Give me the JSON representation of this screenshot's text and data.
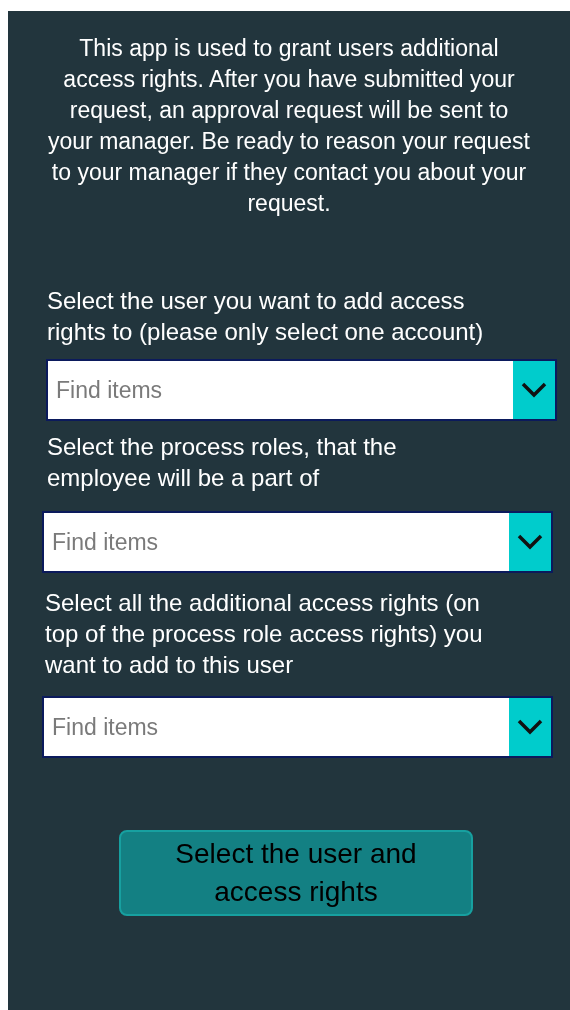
{
  "intro": "This app is used to grant users additional access rights. After you have submitted your request, an approval request will be sent to your manager. Be ready to reason your request to your manager if they contact you about your request.",
  "pickers": [
    {
      "label": "Select the user you want to add access rights to (please only select one account)",
      "placeholder": "Find items"
    },
    {
      "label": "Select the process roles, that the employee will be a part of",
      "placeholder": "Find items"
    },
    {
      "label": "Select all the additional access rights (on top of the process role access rights) you want to add to this user",
      "placeholder": "Find items"
    }
  ],
  "submit_button": "Select the user and access rights"
}
